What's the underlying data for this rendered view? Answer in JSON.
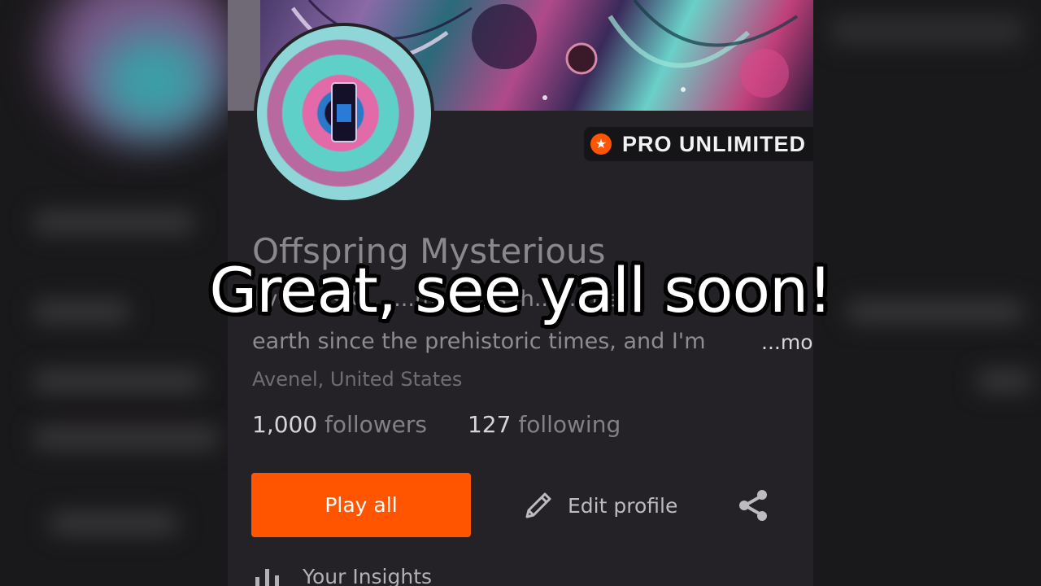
{
  "badge": {
    "label": "PRO UNLIMITED",
    "icon": "star-icon",
    "color": "#ff5500"
  },
  "profile": {
    "name": "Offspring Mysterious",
    "bio_line1": "I've ... is C... ...my... ...s, h... ...the",
    "bio_line2": "earth since the prehistoric times, and I'm",
    "bio_more": "...more",
    "location": "Avenel, United States"
  },
  "stats": {
    "followers_count": "1,000",
    "followers_label": "followers",
    "following_count": "127",
    "following_label": "following"
  },
  "actions": {
    "play_all": "Play all",
    "edit_profile": "Edit profile",
    "share_icon": "share-icon",
    "edit_icon": "pencil-icon"
  },
  "insights": {
    "label": "Your Insights",
    "icon": "bar-chart-icon"
  },
  "caption": {
    "text": "Great, see yall soon!"
  },
  "colors": {
    "accent": "#ff5500",
    "background": "#242226"
  }
}
